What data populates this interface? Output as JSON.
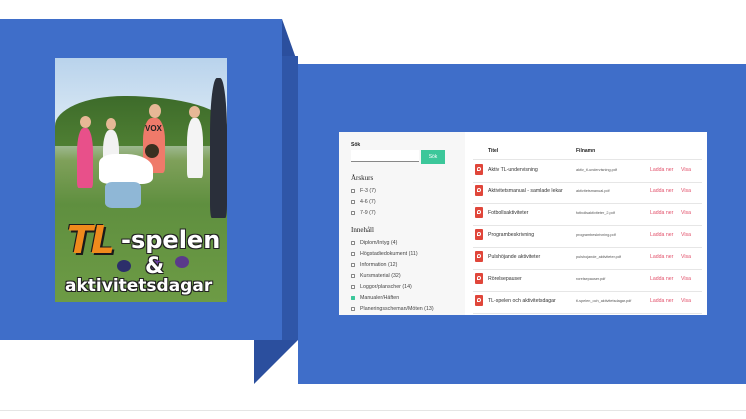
{
  "cover": {
    "logo_tl": "TL",
    "logo_spelen": "-spelen",
    "logo_amp": "&",
    "logo_aktivitetsdagar": "aktivitetsdagar",
    "shirt_text": "VOX"
  },
  "sidebar": {
    "search_label": "Sök",
    "search_value": "",
    "search_button": "Sök",
    "grade_title": "Årskurs",
    "grades": [
      {
        "label": "F-3 (7)",
        "checked": false
      },
      {
        "label": "4-6 (7)",
        "checked": false
      },
      {
        "label": "7-9 (7)",
        "checked": false
      }
    ],
    "content_title": "Innehåll",
    "content_items": [
      {
        "label": "Diplom/Intyg (4)",
        "checked": false
      },
      {
        "label": "Högstadiedokument (11)",
        "checked": false
      },
      {
        "label": "Information (12)",
        "checked": false
      },
      {
        "label": "Kursmaterial (32)",
        "checked": false
      },
      {
        "label": "Loggor/planscher (14)",
        "checked": false
      },
      {
        "label": "Manualer/Häften",
        "checked": true
      },
      {
        "label": "Planeringsscheman/Möten (13)",
        "checked": false
      }
    ]
  },
  "table": {
    "col_title": "Titel",
    "col_file": "Filnamn",
    "rows": [
      {
        "title": "Aktiv TL-undervisning",
        "file": "aktiv_tl-undervisning.pdf",
        "download": "Ladda ner",
        "view": "Visa"
      },
      {
        "title": "Aktivitetsmanual - samlade lekar",
        "file": "aktivitetsmanual.pdf",
        "download": "Ladda ner",
        "view": "Visa"
      },
      {
        "title": "Fotbollsaktiviteter",
        "file": "fotbollsaktiviteter_2.pdf",
        "download": "Ladda ner",
        "view": "Visa"
      },
      {
        "title": "Programbeskrivning",
        "file": "programbeskrivning.pdf",
        "download": "Ladda ner",
        "view": "Visa"
      },
      {
        "title": "Pulshöjande aktiviteter",
        "file": "pulshojande_aktiviteter.pdf",
        "download": "Ladda ner",
        "view": "Visa"
      },
      {
        "title": "Rörelsepauser",
        "file": "rorelsepauser.pdf",
        "download": "Ladda ner",
        "view": "Visa"
      },
      {
        "title": "TL-spelen och aktivitetsdagar",
        "file": "tl-spelen_och_aktivitetsdagar.pdf",
        "download": "Ladda ner",
        "view": "Visa"
      }
    ]
  },
  "colors": {
    "background_blue": "#3f6ec9",
    "accent_green": "#3cc79a",
    "link_pink": "#e2506a",
    "pdf_red": "#e0463a"
  }
}
